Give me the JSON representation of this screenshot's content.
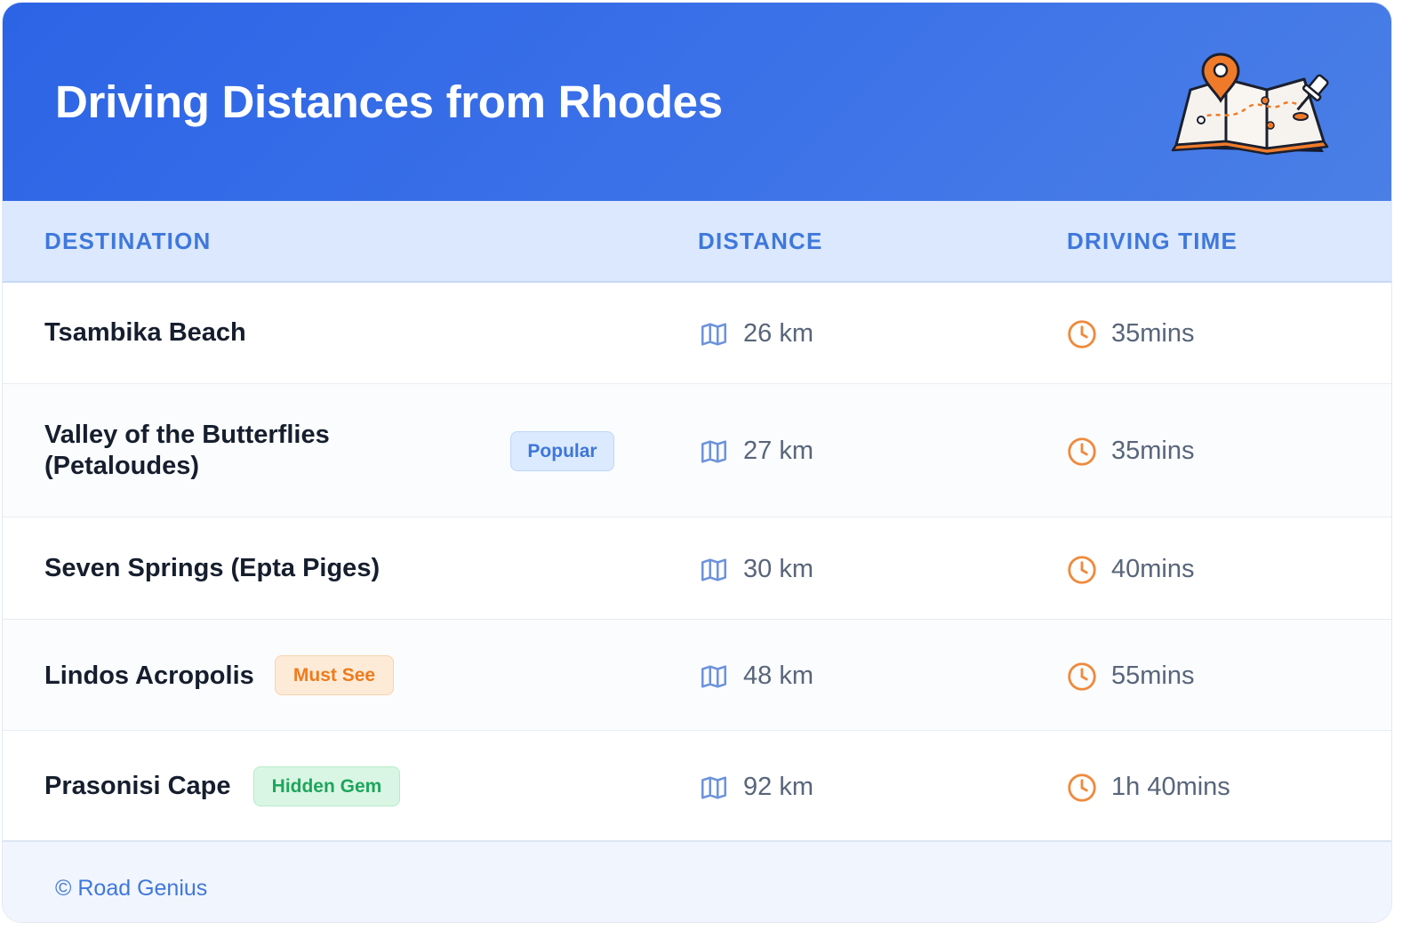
{
  "header": {
    "title": "Driving Distances from Rhodes",
    "illustration": "map-with-pins-illustration"
  },
  "table": {
    "columns": [
      "DESTINATION",
      "DISTANCE",
      "DRIVING TIME"
    ],
    "rows": [
      {
        "destination": "Tsambika Beach",
        "distance": "26 km",
        "time": "35mins"
      },
      {
        "destination": "Valley of the Butterflies",
        "destination_line2": "(Petaloudes)",
        "badge": "Popular",
        "distance": "27 km",
        "time": "35mins"
      },
      {
        "destination": "Seven Springs (Epta Piges)",
        "distance": "30 km",
        "time": "40mins"
      },
      {
        "destination": "Lindos Acropolis",
        "badge": "Must See",
        "distance": "48 km",
        "time": "55mins"
      },
      {
        "destination": "Prasonisi Cape",
        "badge": "Hidden Gem",
        "distance": "92 km",
        "time": "1h 40mins"
      }
    ],
    "icons": {
      "distance": "map-icon",
      "time": "clock-icon"
    }
  },
  "footer": {
    "credit": "© Road Genius"
  },
  "colors": {
    "header_bg": "#2c64e6",
    "header_text": "#ffffff",
    "column_header_bg": "#dbe8fd",
    "column_header_text": "#3f78dc",
    "map_icon": "#6d93dc",
    "clock_icon": "#ef8a3c",
    "badge_popular": "#dbeafe",
    "badge_must_see": "#fdebd8",
    "badge_hidden_gem": "#d9f6e4"
  }
}
